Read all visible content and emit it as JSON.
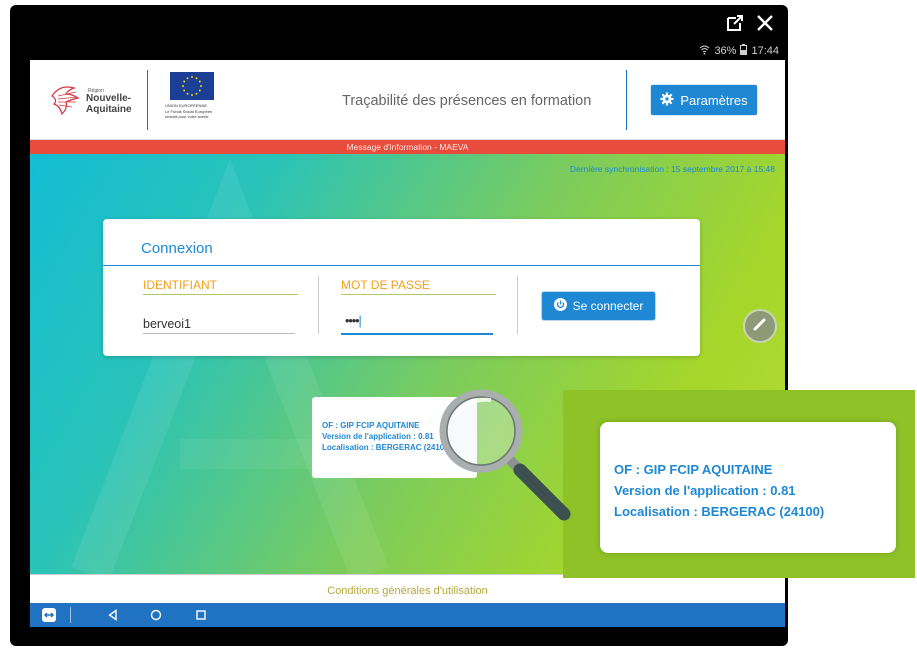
{
  "window": {
    "controls": [
      {
        "icon": "open-external-icon"
      },
      {
        "icon": "close-icon",
        "label": "✕"
      }
    ]
  },
  "status_bar": {
    "battery": "36%",
    "time": "17:44",
    "icons": [
      "wifi-icon",
      "battery-icon"
    ]
  },
  "header": {
    "region_logo": {
      "small_text": "Région",
      "line1": "Nouvelle-",
      "line2": "Aquitaine"
    },
    "eu_logo": {
      "cap1": "UNION EUROPÉENNE",
      "cap2": "Le Fonds Social Européen",
      "cap3": "investit pour votre avenir"
    },
    "app_title": "Traçabilité des présences en formation",
    "params_button": {
      "label": "Paramètres",
      "icon": "gear-icon"
    }
  },
  "message_band": "Message d'information - MAEVA",
  "sync_text": "Dernière synchronisation : 15 septembre 2017 à 15:48",
  "login": {
    "title": "Connexion",
    "username_label": "IDENTIFIANT",
    "username_value": "berveoi1",
    "password_label": "MOT DE PASSE",
    "password_value": "••••",
    "connect_button": {
      "label": "Se connecter",
      "icon": "power-icon"
    }
  },
  "info": {
    "of": "OF : GIP FCIP AQUITAINE",
    "version": "Version de l'application : 0.81",
    "location": "Localisation : BERGERAC (24100)"
  },
  "footer": {
    "terms_link": "Conditions générales d'utilisation"
  },
  "nav_bar": {
    "buttons": [
      "teamviewer-icon",
      "back-icon",
      "home-icon",
      "recents-icon"
    ]
  },
  "colors": {
    "accent_blue": "#1e88d4",
    "message_red": "#e84c3d",
    "label_orange": "#f2a01b",
    "nav_blue": "#1f73c2",
    "zoom_green": "#8fc227"
  }
}
